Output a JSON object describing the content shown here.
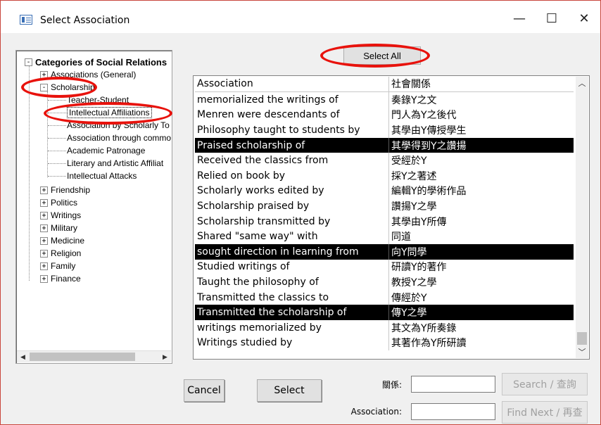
{
  "window": {
    "title": "Select Association",
    "minimize_glyph": "—",
    "maximize_glyph": "☐",
    "close_glyph": "✕"
  },
  "tree": {
    "root": {
      "label": "Categories of Social Relations",
      "expander": "-"
    },
    "items": [
      {
        "label": "Associations (General)",
        "expander": "+"
      },
      {
        "label": "Scholarship",
        "expander": "-"
      }
    ],
    "scholarship_children": [
      "Teacher-Student",
      "Intellectual Affiliations",
      "Association by Scholarly To",
      "Association through commo",
      "Academic Patronage",
      "Literary and Artistic Affiliat",
      "Intellectual Attacks"
    ],
    "other_items": [
      {
        "label": "Friendship",
        "expander": "+"
      },
      {
        "label": "Politics",
        "expander": "+"
      },
      {
        "label": "Writings",
        "expander": "+"
      },
      {
        "label": "Military",
        "expander": "+"
      },
      {
        "label": "Medicine",
        "expander": "+"
      },
      {
        "label": "Religion",
        "expander": "+"
      },
      {
        "label": "Family",
        "expander": "+"
      },
      {
        "label": "Finance",
        "expander": "+"
      }
    ],
    "scroll_left": "◀",
    "scroll_right": "▶"
  },
  "select_all_label": "Select All",
  "list": {
    "headers": [
      "Association",
      "社會關係"
    ],
    "rows": [
      {
        "en": "memorialized the writings of",
        "zh": "奏錄Y之文",
        "selected": false
      },
      {
        "en": "Menren were descendants of",
        "zh": "門人為Y之後代",
        "selected": false
      },
      {
        "en": "Philosophy taught to students by",
        "zh": "其學由Y傳授學生",
        "selected": false
      },
      {
        "en": "Praised scholarship of",
        "zh": "其學得到Y之讚揚",
        "selected": true
      },
      {
        "en": "Received the classics from",
        "zh": "受經於Y",
        "selected": false
      },
      {
        "en": "Relied on book by",
        "zh": "採Y之著述",
        "selected": false
      },
      {
        "en": "Scholarly works edited by",
        "zh": "編輯Y的學術作品",
        "selected": false
      },
      {
        "en": "Scholarship praised by",
        "zh": "讚揚Y之學",
        "selected": false
      },
      {
        "en": "Scholarship transmitted by",
        "zh": "其學由Y所傳",
        "selected": false
      },
      {
        "en": "Shared \"same way\" with",
        "zh": "同道",
        "selected": false
      },
      {
        "en": "sought direction in learning from",
        "zh": "向Y問學",
        "selected": true
      },
      {
        "en": "Studied writings of",
        "zh": "研讀Y的著作",
        "selected": false
      },
      {
        "en": "Taught the philosophy of",
        "zh": "教授Y之學",
        "selected": false
      },
      {
        "en": "Transmitted the classics to",
        "zh": "傳經於Y",
        "selected": false
      },
      {
        "en": "Transmitted the scholarship of",
        "zh": "傳Y之學",
        "selected": true
      },
      {
        "en": "writings memorialized by",
        "zh": "其文為Y所奏錄",
        "selected": false
      },
      {
        "en": "Writings studied by",
        "zh": "其著作為Y所研讀",
        "selected": false
      }
    ],
    "scroll_up": "︿",
    "scroll_down": "﹀"
  },
  "buttons": {
    "cancel": "Cancel",
    "select": "Select",
    "search": "Search / 查詢",
    "find_next": "Find Next / 再查"
  },
  "fields": {
    "relation_label": "關係:",
    "relation_value": "",
    "association_label": "Association:",
    "association_value": ""
  },
  "colors": {
    "selection_bg": "#000000",
    "annotation": "#e8120c",
    "window_border": "#c9463d"
  }
}
